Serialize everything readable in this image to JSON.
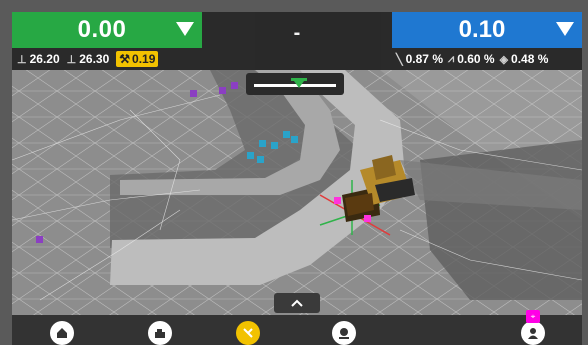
{
  "left_panel": {
    "value": "0.00",
    "left_height": "26.20",
    "right_height": "26.30",
    "cut_fill": "0.19",
    "color": "#27a844"
  },
  "center_panel": {
    "value": "-"
  },
  "right_panel": {
    "value": "0.10",
    "slope_main": "0.87 %",
    "slope_cross": "0.60 %",
    "slope_blade": "0.48 %",
    "color": "#1f78d1"
  },
  "icons": {
    "left_height": "blade-left-height-icon",
    "right_height": "blade-right-height-icon",
    "cut_fill": "cut-fill-icon",
    "slope_main": "main-slope-icon",
    "slope_cross": "cross-slope-icon",
    "slope_blade": "blade-slope-icon",
    "nav_home": "home-icon",
    "nav_machine": "machine-icon",
    "nav_grade": "grade-icon",
    "nav_map": "map-pin-icon",
    "nav_user": "user-location-icon",
    "expand": "chevron-up-icon"
  }
}
